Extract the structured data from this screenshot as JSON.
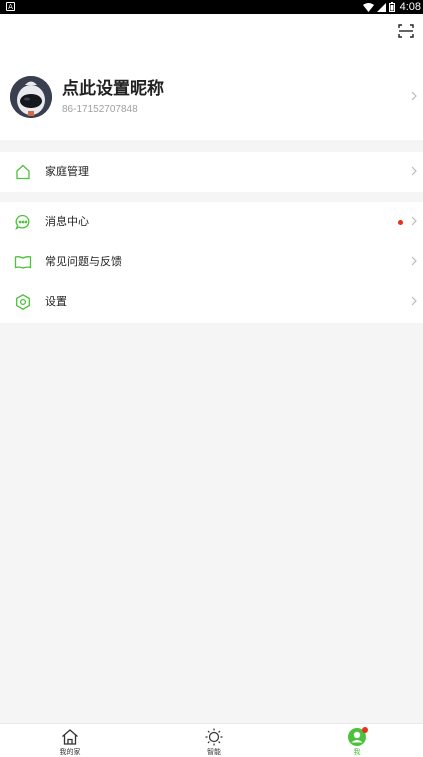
{
  "status_bar": {
    "time": "4:08",
    "left_icon_letter": "A"
  },
  "profile": {
    "nickname": "点此设置昵称",
    "phone": "86-17152707848"
  },
  "menu_group_1": [
    {
      "label": "家庭管理",
      "icon": "home-icon"
    }
  ],
  "menu_group_2": [
    {
      "label": "消息中心",
      "icon": "message-icon",
      "has_unread_dot": true
    },
    {
      "label": "常见问题与反馈",
      "icon": "book-icon"
    },
    {
      "label": "设置",
      "icon": "settings-hexagon-icon"
    }
  ],
  "tab_bar": [
    {
      "label": "我的家",
      "icon": "home-outline-icon",
      "active": false
    },
    {
      "label": "智能",
      "icon": "sun-icon",
      "active": false
    },
    {
      "label": "我",
      "icon": "person-icon",
      "active": true,
      "has_badge": true
    }
  ],
  "colors": {
    "accent": "#4cc13b",
    "badge": "#e8311a",
    "background": "#f5f5f5"
  }
}
